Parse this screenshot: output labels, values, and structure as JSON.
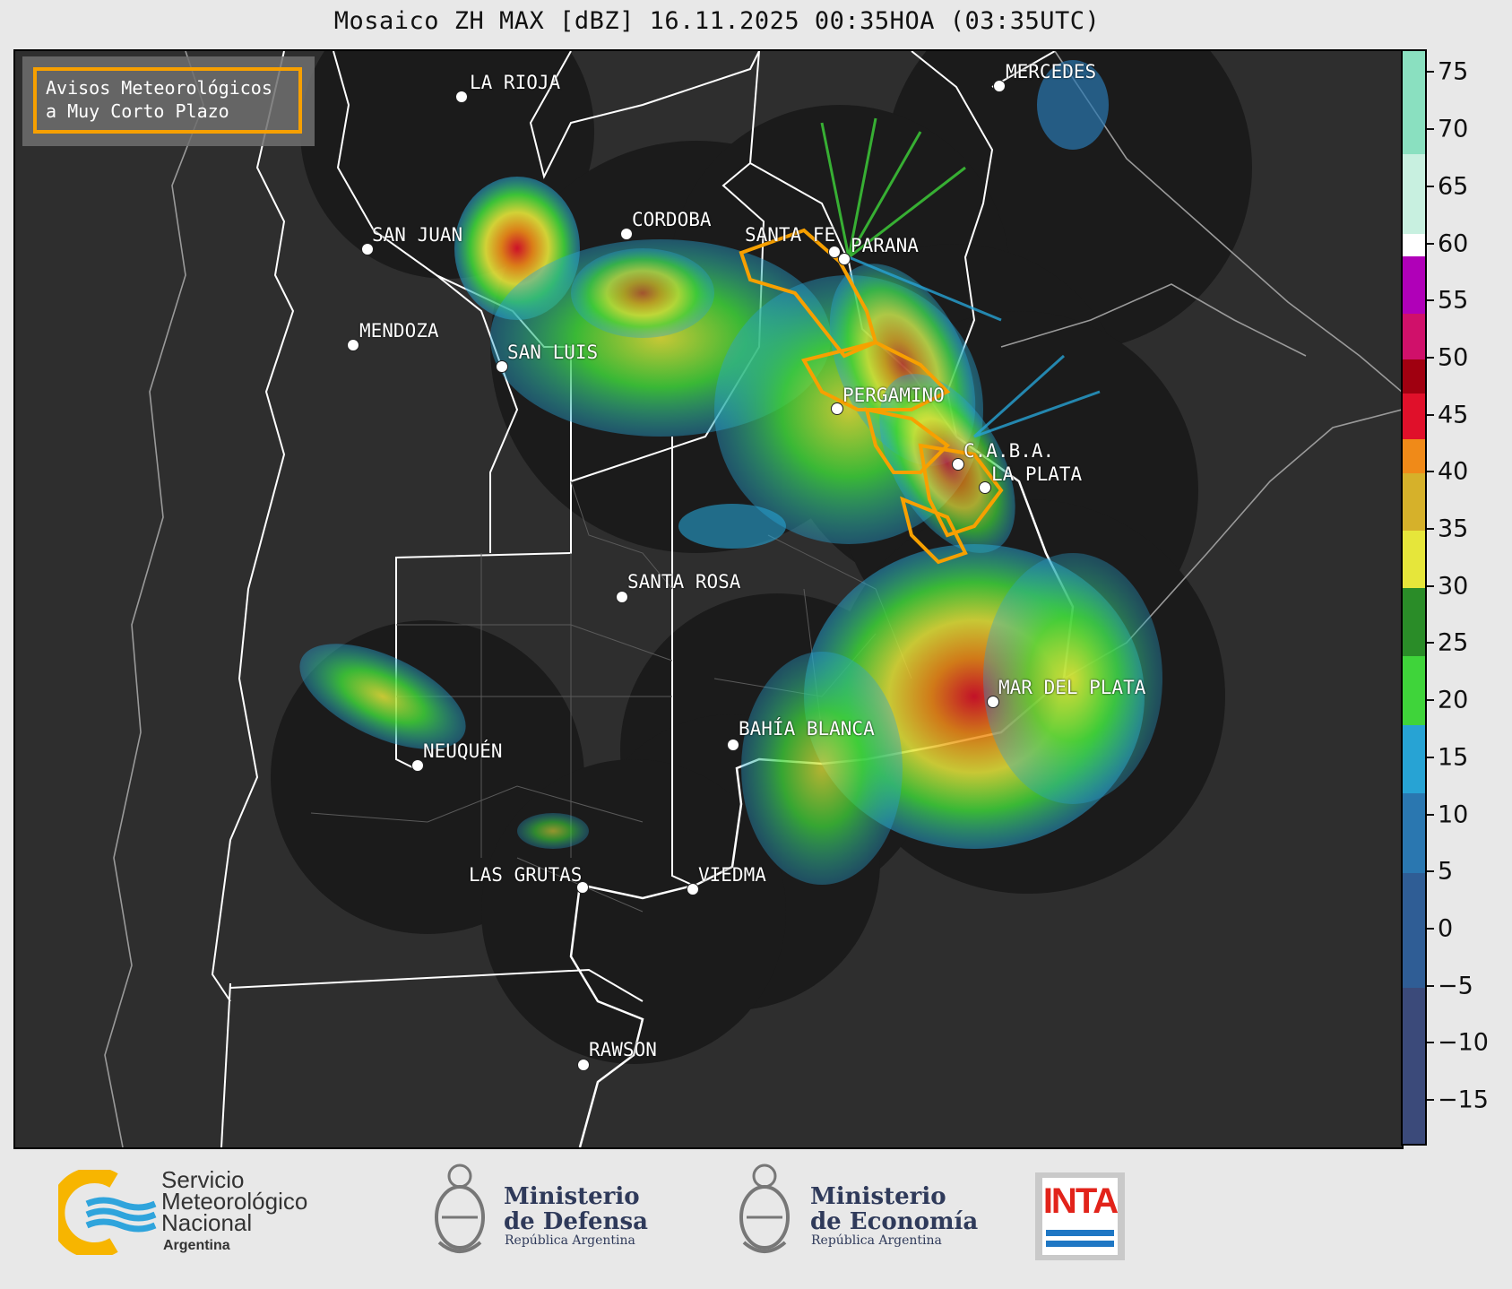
{
  "title": "Mosaico ZH MAX [dBZ] 16.11.2025 00:35HOA (03:35UTC)",
  "legend": {
    "line1": "Avisos Meteorológicos",
    "line2": "a Muy Corto Plazo",
    "border_color": "#f7a000"
  },
  "cities": [
    {
      "id": "la-rioja",
      "name": "LA RIOJA"
    },
    {
      "id": "mercedes",
      "name": "MERCEDES"
    },
    {
      "id": "cordoba",
      "name": "CORDOBA"
    },
    {
      "id": "san-juan",
      "name": "SAN JUAN"
    },
    {
      "id": "santa-fe",
      "name": "SANTA FE"
    },
    {
      "id": "parana",
      "name": "PARANA"
    },
    {
      "id": "mendoza",
      "name": "MENDOZA"
    },
    {
      "id": "san-luis",
      "name": "SAN LUIS"
    },
    {
      "id": "pergamino",
      "name": "PERGAMINO"
    },
    {
      "id": "caba",
      "name": "C.A.B.A."
    },
    {
      "id": "la-plata",
      "name": "LA PLATA"
    },
    {
      "id": "santa-rosa",
      "name": "SANTA ROSA"
    },
    {
      "id": "mar-del-plata",
      "name": "MAR DEL PLATA"
    },
    {
      "id": "bahia-blanca",
      "name": "BAHÍA BLANCA"
    },
    {
      "id": "neuquen",
      "name": "NEUQUÉN"
    },
    {
      "id": "las-grutas",
      "name": "LAS GRUTAS"
    },
    {
      "id": "viedma",
      "name": "VIEDMA"
    },
    {
      "id": "rawson",
      "name": "RAWSON"
    }
  ],
  "colorbar": {
    "unit": "dBZ",
    "range": [
      -19,
      77
    ],
    "ticks": [
      75,
      70,
      65,
      60,
      55,
      50,
      45,
      40,
      35,
      30,
      25,
      20,
      15,
      10,
      5,
      0,
      -5,
      -10,
      -15
    ],
    "tick_labels": [
      "75",
      "70",
      "65",
      "60",
      "55",
      "50",
      "45",
      "40",
      "35",
      "30",
      "25",
      "20",
      "15",
      "10",
      "5",
      "0",
      "−5",
      "−10",
      "−15"
    ],
    "stops": [
      {
        "from": -19,
        "to": -5,
        "color": "#3b4a7a"
      },
      {
        "from": -5,
        "to": 5,
        "color": "#2f5d95"
      },
      {
        "from": 5,
        "to": 12,
        "color": "#2a77b0"
      },
      {
        "from": 12,
        "to": 18,
        "color": "#27a3d4"
      },
      {
        "from": 18,
        "to": 24,
        "color": "#3fd43a"
      },
      {
        "from": 24,
        "to": 30,
        "color": "#2a8c28"
      },
      {
        "from": 30,
        "to": 35,
        "color": "#e6e63a"
      },
      {
        "from": 35,
        "to": 40,
        "color": "#d6b12a"
      },
      {
        "from": 40,
        "to": 43,
        "color": "#f08a18"
      },
      {
        "from": 43,
        "to": 47,
        "color": "#e0102a"
      },
      {
        "from": 47,
        "to": 50,
        "color": "#a00010"
      },
      {
        "from": 50,
        "to": 54,
        "color": "#d0106a"
      },
      {
        "from": 54,
        "to": 59,
        "color": "#b000b8"
      },
      {
        "from": 59,
        "to": 61,
        "color": "#ffffff"
      },
      {
        "from": 61,
        "to": 68,
        "color": "#c8f0e0"
      },
      {
        "from": 68,
        "to": 77,
        "color": "#8ae0c0"
      }
    ]
  },
  "footer": {
    "smn": {
      "line1": "Servicio",
      "line2": "Meteorológico",
      "line3": "Nacional",
      "sub": "Argentina"
    },
    "defensa": {
      "line1": "Ministerio",
      "line2": "de Defensa",
      "sub": "República Argentina"
    },
    "economia": {
      "line1": "Ministerio",
      "line2": "de Economía",
      "sub": "República Argentina"
    },
    "inta": {
      "label": "INTA"
    }
  }
}
